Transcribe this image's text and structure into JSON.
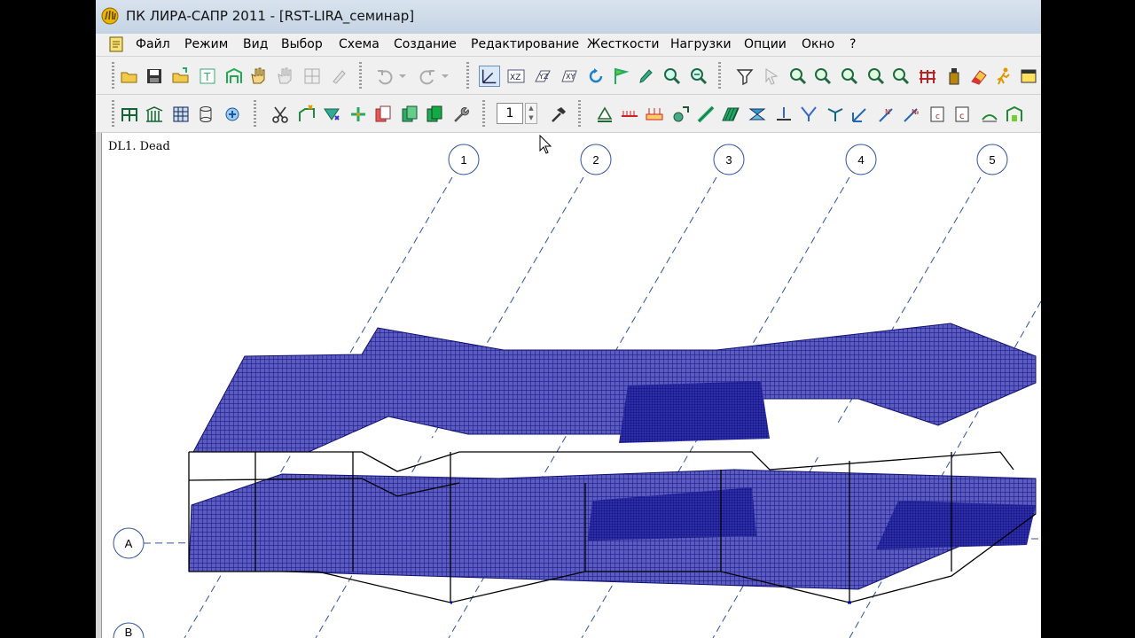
{
  "window": {
    "title": "ПК ЛИРА-САПР  2011 - [RST-LIRA_семинар]"
  },
  "menu": {
    "items": [
      "Файл",
      "Режим",
      "Вид",
      "Выбор",
      "Схема",
      "Создание",
      "Редактирование",
      "Жесткости",
      "Нагрузки",
      "Опции",
      "Окно",
      "?"
    ]
  },
  "toolbar2": {
    "step_value": "1"
  },
  "viewport": {
    "load_case_label": "DL1. Dead",
    "axes_numeric": [
      "1",
      "2",
      "3",
      "4",
      "5"
    ],
    "axes_letter": [
      "A",
      "B"
    ],
    "mesh_color": "#1f1f8c",
    "frame_color": "#000000"
  },
  "colors": {
    "title_bar": "#c9d7e8",
    "toolbar_bg": "#f0f0f0"
  }
}
